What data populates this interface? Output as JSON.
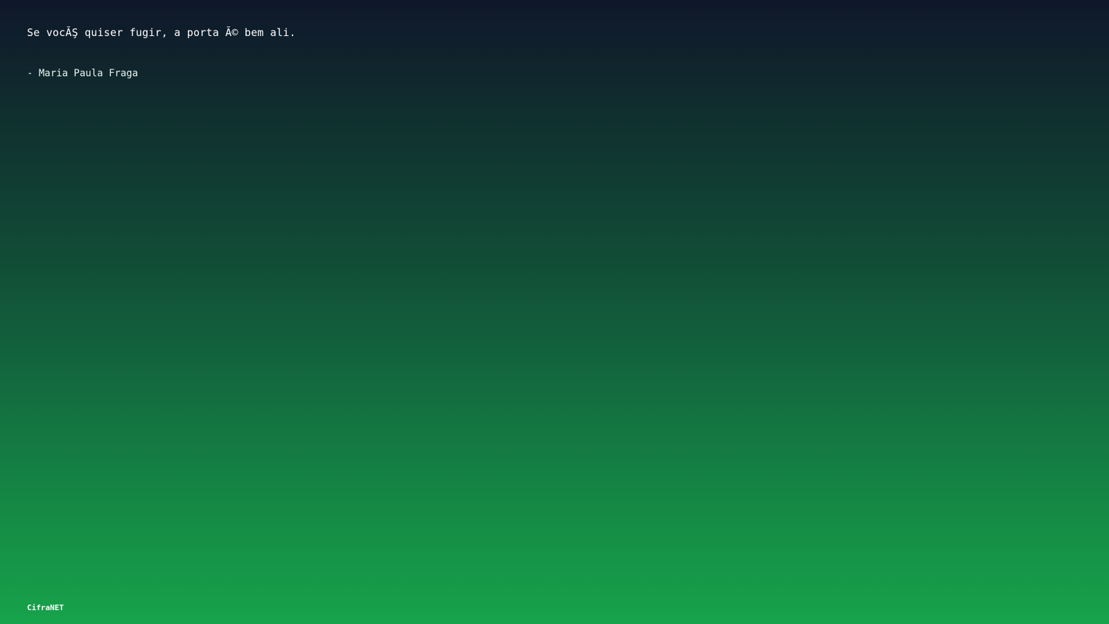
{
  "quote": {
    "text": "Se vocĂŞ quiser fugir, a porta Ă© bem ali.",
    "author": "- Maria Paula Fraga"
  },
  "footer": {
    "brand": "CifraNET"
  },
  "colors": {
    "gradient_top": "#0f172a",
    "gradient_bottom": "#16a34a",
    "text": "#ffffff"
  }
}
